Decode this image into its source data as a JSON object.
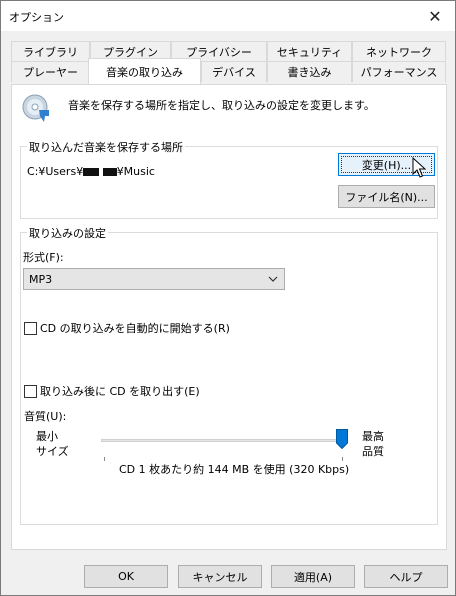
{
  "window": {
    "title": "オプション",
    "close_glyph": "✕"
  },
  "tabs": {
    "row1": [
      "ライブラリ",
      "プラグイン",
      "プライバシー",
      "セキュリティ",
      "ネットワーク"
    ],
    "row2": [
      "プレーヤー",
      "音楽の取り込み",
      "デバイス",
      "書き込み",
      "パフォーマンス"
    ],
    "active": "音楽の取り込み"
  },
  "header": {
    "icon": "cd-rip-icon",
    "description": "音楽を保存する場所を指定し、取り込みの設定を変更します。"
  },
  "location": {
    "group_label": "取り込んだ音楽を保存する場所",
    "path_prefix": "C:¥Users¥",
    "path_suffix": "¥Music",
    "change_button": "変更(H)...",
    "filename_button": "ファイル名(N)..."
  },
  "settings": {
    "group_label": "取り込みの設定",
    "format_label": "形式(F):",
    "format_value": "MP3",
    "auto_rip_label": "CD の取り込みを自動的に開始する(R)",
    "auto_rip_checked": false,
    "eject_label": "取り込み後に CD を取り出す(E)",
    "eject_checked": false,
    "quality_label": "音質(U):",
    "min_label_1": "最小",
    "min_label_2": "サイズ",
    "max_label_1": "最高",
    "max_label_2": "品質",
    "quality_level": 1.0,
    "quality_info": "CD 1 枚あたり約 144 MB を使用 (320 Kbps)"
  },
  "footer": {
    "ok": "OK",
    "cancel": "キャンセル",
    "apply": "適用(A)",
    "help": "ヘルプ"
  },
  "colors": {
    "accent": "#0078d7",
    "panel_bg": "#ffffff",
    "window_bg": "#f0f0f0"
  }
}
